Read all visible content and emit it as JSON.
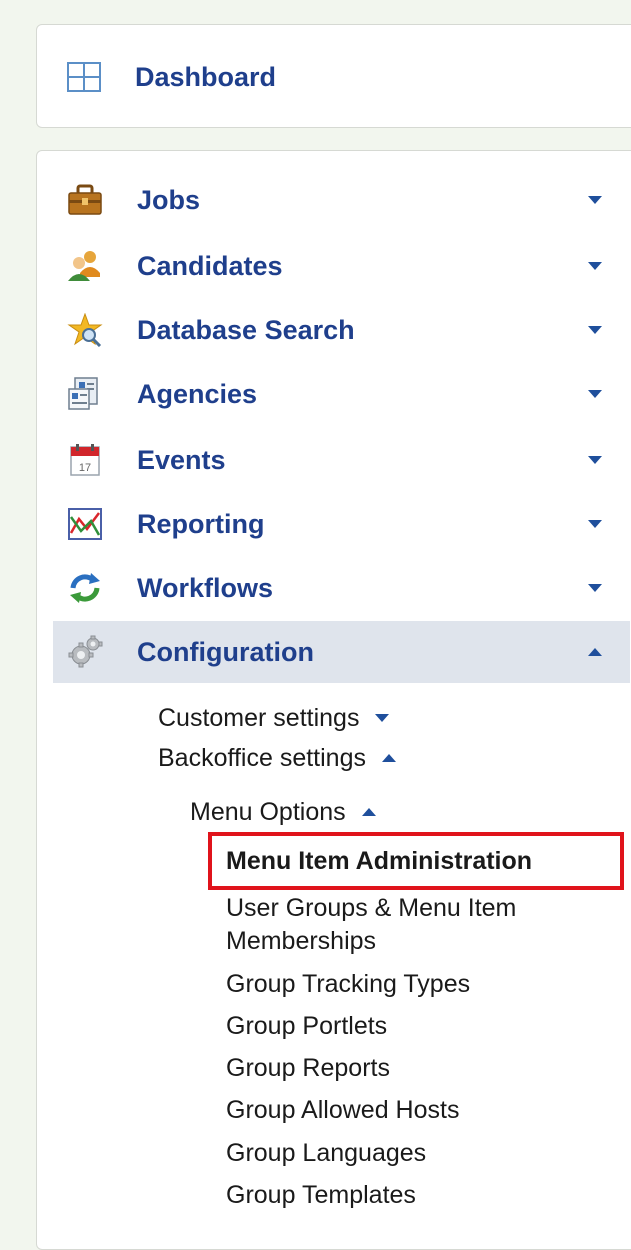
{
  "dashboard": {
    "label": "Dashboard",
    "icon": "grid-icon"
  },
  "nav": {
    "items": [
      {
        "label": "Jobs",
        "icon": "briefcase-icon",
        "expanded": false
      },
      {
        "label": "Candidates",
        "icon": "users-icon",
        "expanded": false
      },
      {
        "label": "Database Search",
        "icon": "star-search-icon",
        "expanded": false
      },
      {
        "label": "Agencies",
        "icon": "agencies-icon",
        "expanded": false
      },
      {
        "label": "Events",
        "icon": "calendar-icon",
        "expanded": false
      },
      {
        "label": "Reporting",
        "icon": "chart-icon",
        "expanded": false
      },
      {
        "label": "Workflows",
        "icon": "refresh-icon",
        "expanded": false
      },
      {
        "label": "Configuration",
        "icon": "gear-icon",
        "expanded": true
      }
    ]
  },
  "configuration": {
    "customer_settings": "Customer settings",
    "backoffice_settings": "Backoffice settings",
    "menu_options": "Menu Options",
    "menu_items": [
      "Menu Item Administration",
      "User Groups & Menu Item",
      "Memberships",
      "Group Tracking Types",
      "Group Portlets",
      "Group Reports",
      "Group Allowed Hosts",
      "Group Languages",
      "Group Templates"
    ]
  },
  "colors": {
    "nav_text": "#1f3f8c",
    "active_bg": "#dfe4ec",
    "highlight": "#e0131b",
    "page_bg": "#f2f6ee"
  }
}
